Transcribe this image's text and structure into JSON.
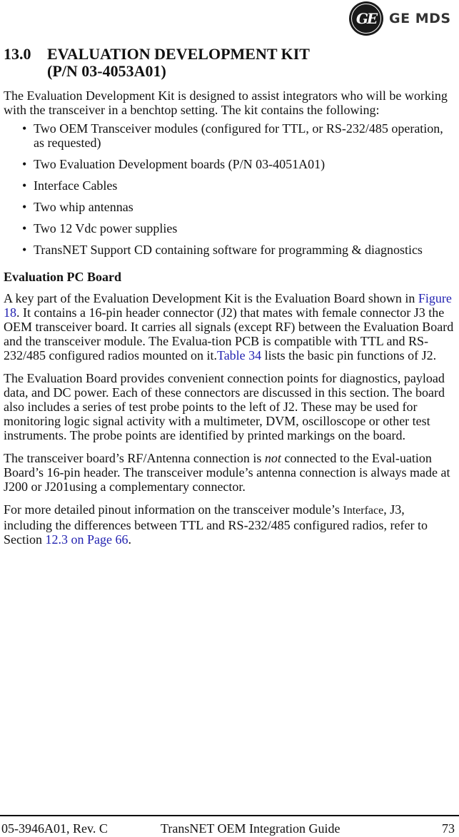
{
  "header": {
    "logo_monogram": "GE",
    "brand_text": "GE MDS"
  },
  "section": {
    "number": "13.0",
    "title_line1": "EVALUATION DEVELOPMENT KIT",
    "title_line2": "(P/N 03-4053A01)"
  },
  "intro": "The Evaluation Development Kit is designed to assist integrators who will be working with the transceiver in a benchtop setting. The kit contains the following:",
  "kit_items": [
    "Two OEM Transceiver modules (configured for TTL, or RS-232/485 operation, as requested)",
    "Two Evaluation Development boards (P/N 03-4051A01)",
    "Interface Cables",
    "Two whip antennas",
    "Two 12 Vdc power supplies",
    "TransNET Support CD containing software for programming & diagnostics"
  ],
  "bullet_glyph": "•",
  "subsection": {
    "heading": "Evaluation PC Board",
    "para1": {
      "t1": "A key part of the Evaluation Development Kit is the Evaluation Board shown in ",
      "link1": "Figure 18",
      "t2": ". It contains a 16-pin header connector (J2) that mates with female connector J3 the OEM transceiver board. It carries all signals (except RF) between the Evaluation Board and the transceiver module. The Evalua-tion PCB is compatible with TTL and RS-232/485 configured radios mounted on it.",
      "link2": "Table 34",
      "t3": " lists the basic pin functions of J2."
    },
    "para2": "The Evaluation Board provides convenient connection points for diagnostics, payload data, and DC power. Each of these connectors are discussed in this section. The board also includes a series of test probe points to the left of J2. These may be used for monitoring logic signal activity with a multimeter, DVM, oscilloscope or other test instruments. The probe points are identified by printed markings on the board.",
    "para3": {
      "t1": "The transceiver board’s RF/Antenna connection is ",
      "em": "not",
      "t2": " connected to the Eval-uation Board’s 16-pin header. The transceiver module’s antenna connection is always made at J200 or J201using a complementary connector."
    },
    "para4": {
      "t1": "For more detailed pinout information on the transceiver module’s ",
      "small": "Interface",
      "t2": ", J3, including the differences between TTL and RS-232/485 configured radios, refer to Section ",
      "link": "12.3 on Page 66",
      "t3": "."
    }
  },
  "footer": {
    "doc_number": "05-3946A01, Rev. C",
    "guide_title": "TransNET OEM Integration Guide",
    "page_number": "73"
  }
}
